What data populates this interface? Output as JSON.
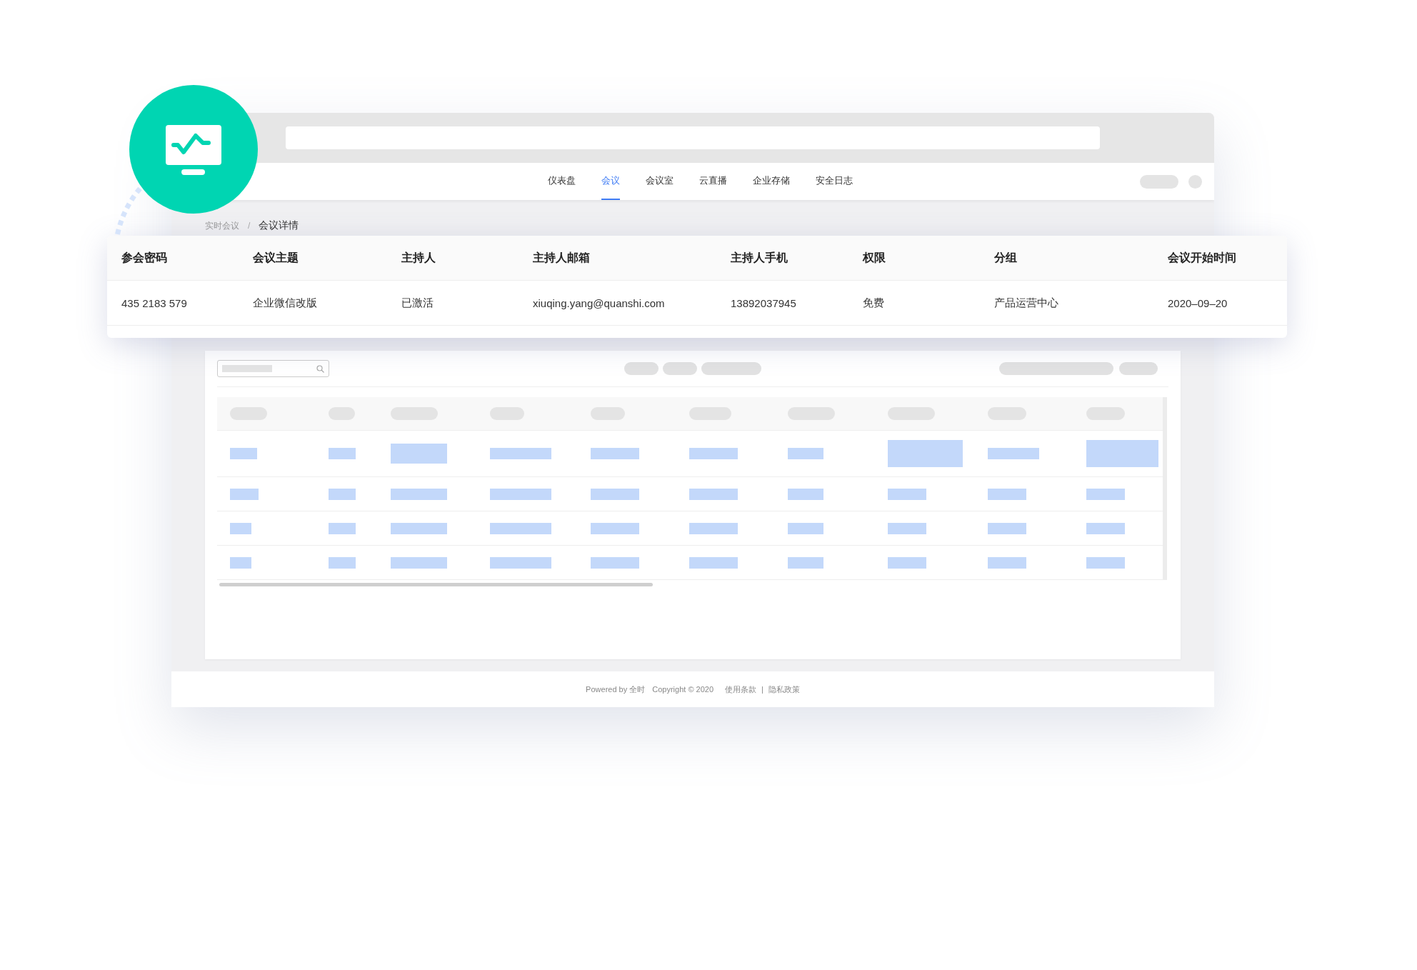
{
  "nav": {
    "items": [
      {
        "label": "仪表盘",
        "selected": false
      },
      {
        "label": "会议",
        "selected": true
      },
      {
        "label": "会议室",
        "selected": false
      },
      {
        "label": "云直播",
        "selected": false
      },
      {
        "label": "企业存储",
        "selected": false
      },
      {
        "label": "安全日志",
        "selected": false
      }
    ]
  },
  "breadcrumb": [
    {
      "label": "实时会议",
      "current": false
    },
    {
      "label": "会议详情",
      "current": true
    }
  ],
  "breadcrumb_separator": "/",
  "detail_table": {
    "columns": [
      "参会密码",
      "会议主题",
      "主持人",
      "主持人邮箱",
      "主持人手机",
      "权限",
      "分组",
      "会议开始时间"
    ],
    "rows": [
      [
        "435 2183 579",
        "企业微信改版",
        "已激活",
        "xiuqing.yang@quanshi.com",
        "13892037945",
        "免费",
        "产品运营中心",
        "2020–09–20"
      ]
    ]
  },
  "footer": {
    "powered": "Powered by 全时",
    "copyright": "Copyright © 2020",
    "links": [
      "使用条款",
      "隐私政策"
    ],
    "separator": "|"
  }
}
